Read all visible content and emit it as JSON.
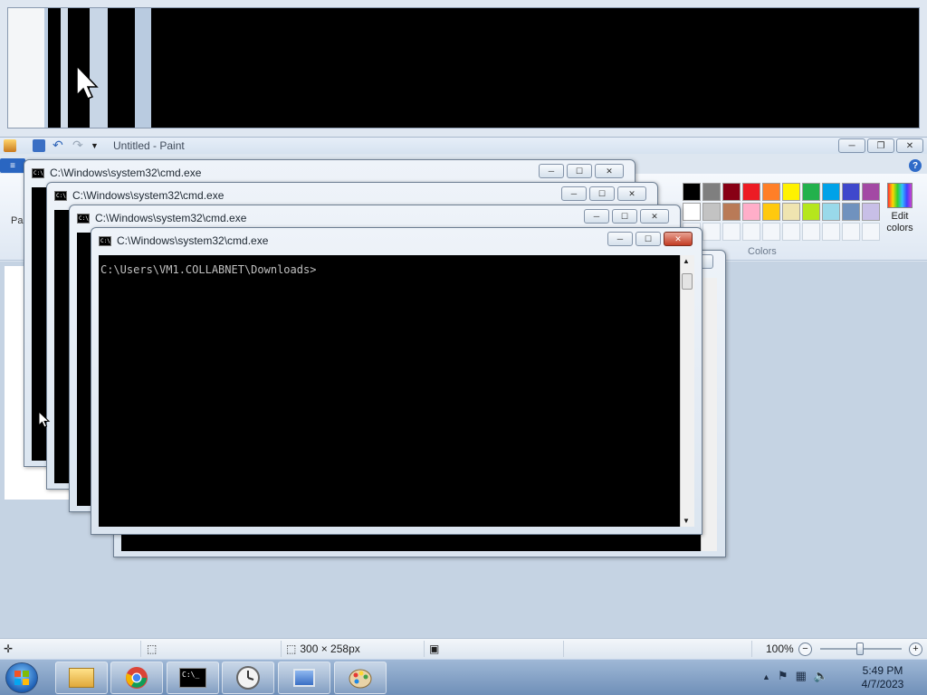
{
  "magnifier": {},
  "paint": {
    "title": "Untitled - Paint",
    "window_controls": {
      "minimize": "─",
      "maximize": "❐",
      "close": "✕"
    },
    "file_tab_label": "≡",
    "help_label": "?",
    "left_group_label": "Pa",
    "colors_label": "Colors",
    "edit_colors_label": "Edit colors",
    "palette": [
      "#000000",
      "#7f7f7f",
      "#880015",
      "#ed1c24",
      "#ff7f27",
      "#fff200",
      "#22b14c",
      "#00a2e8",
      "#3f48cc",
      "#a349a4",
      "#ffffff",
      "#c3c3c3",
      "#b97a57",
      "#ffaec9",
      "#ffc90e",
      "#efe4b0",
      "#b5e61d",
      "#99d9ea",
      "#7092be",
      "#c8bfe7"
    ],
    "status": {
      "canvas_size": "300 × 258px",
      "zoom": "100%",
      "zoom_out": "−",
      "zoom_in": "+"
    }
  },
  "cmd_windows": [
    {
      "title": "C:\\Windows\\system32\\cmd.exe"
    },
    {
      "title": "C:\\Windows\\system32\\cmd.exe"
    },
    {
      "title": "C:\\Windows\\system32\\cmd.exe"
    },
    {
      "title": "C:\\Windows\\system32\\cmd.exe",
      "prompt": "C:\\Users\\VM1.COLLABNET\\Downloads>"
    }
  ],
  "cmd_controls": {
    "minimize": "─",
    "maximize": "☐",
    "close": "✕"
  },
  "taskbar": {
    "apps": [
      "file-explorer",
      "chrome",
      "cmd",
      "clock",
      "network",
      "paint"
    ],
    "clock_time": "5:49 PM",
    "clock_date": "4/7/2023",
    "tray_expand": "▲"
  }
}
